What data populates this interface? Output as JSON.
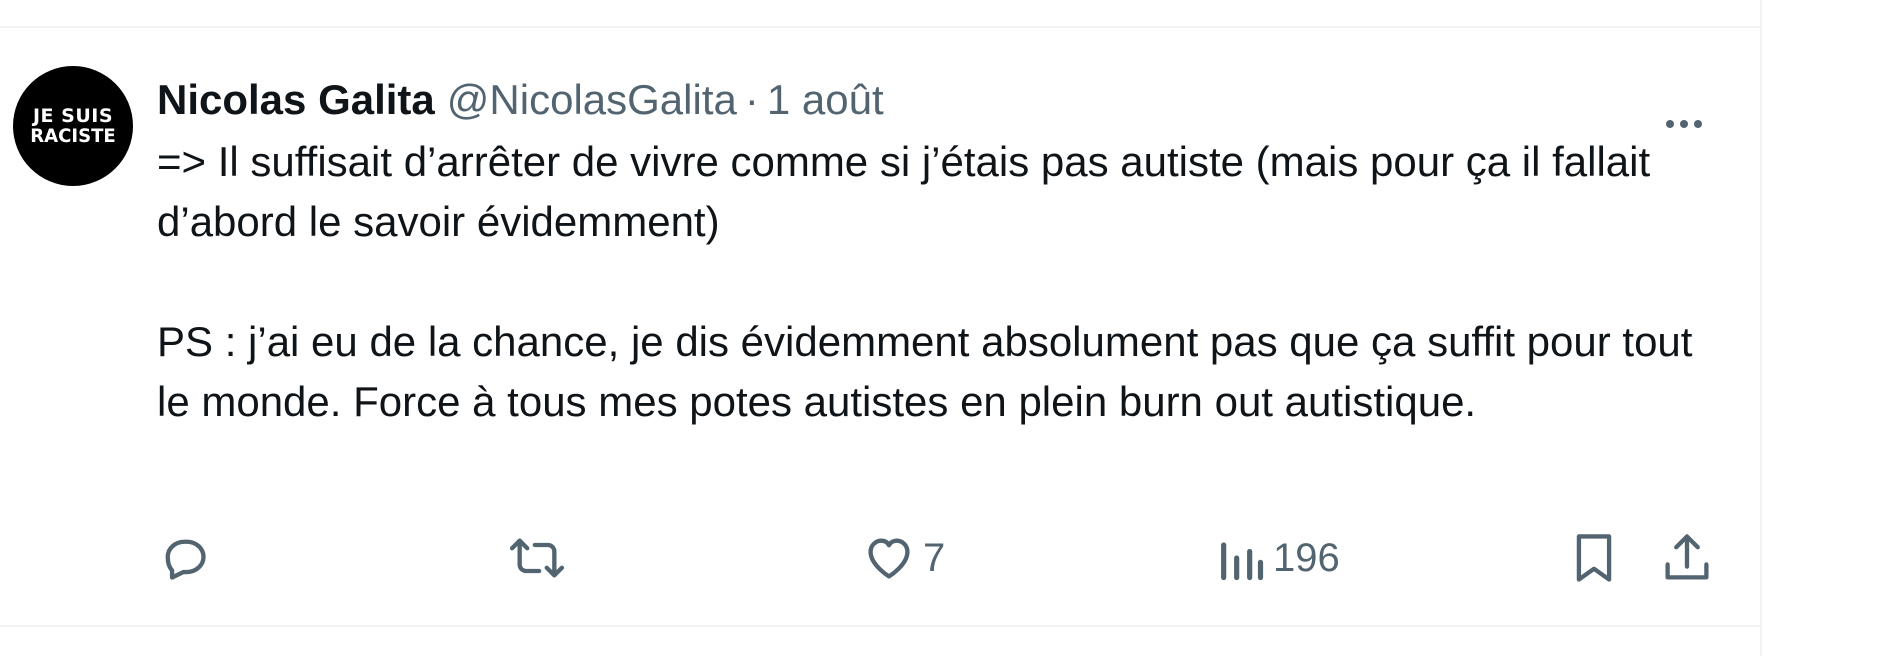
{
  "tweet": {
    "avatar": {
      "line1": "JE SUIS",
      "line2": "RACISTE"
    },
    "author_name": "Nicolas Galita",
    "handle": "@NicolasGalita",
    "separator": "·",
    "date": "1 août",
    "more_icon": "more-horizontal-icon",
    "text": {
      "p1": "=> Il suffisait d’arrêter de vivre comme si j’étais pas autiste (mais pour ça il fallait d’abord le savoir évidemment)",
      "p2": "PS : j’ai eu de la chance, je dis évidemment absolument pas que ça suffit pour tout le monde. Force à tous mes potes autistes en plein burn out autistique."
    },
    "actions": {
      "reply": {
        "icon": "reply-icon"
      },
      "retweet": {
        "icon": "retweet-icon"
      },
      "like": {
        "icon": "heart-icon",
        "count": "7"
      },
      "views": {
        "icon": "views-icon",
        "count": "196"
      },
      "bookmark": {
        "icon": "bookmark-icon"
      },
      "share": {
        "icon": "share-icon"
      }
    }
  },
  "colors": {
    "text_primary": "#0f1419",
    "text_secondary": "#536471",
    "border": "#eff3f4",
    "avatar_bg": "#000000"
  }
}
